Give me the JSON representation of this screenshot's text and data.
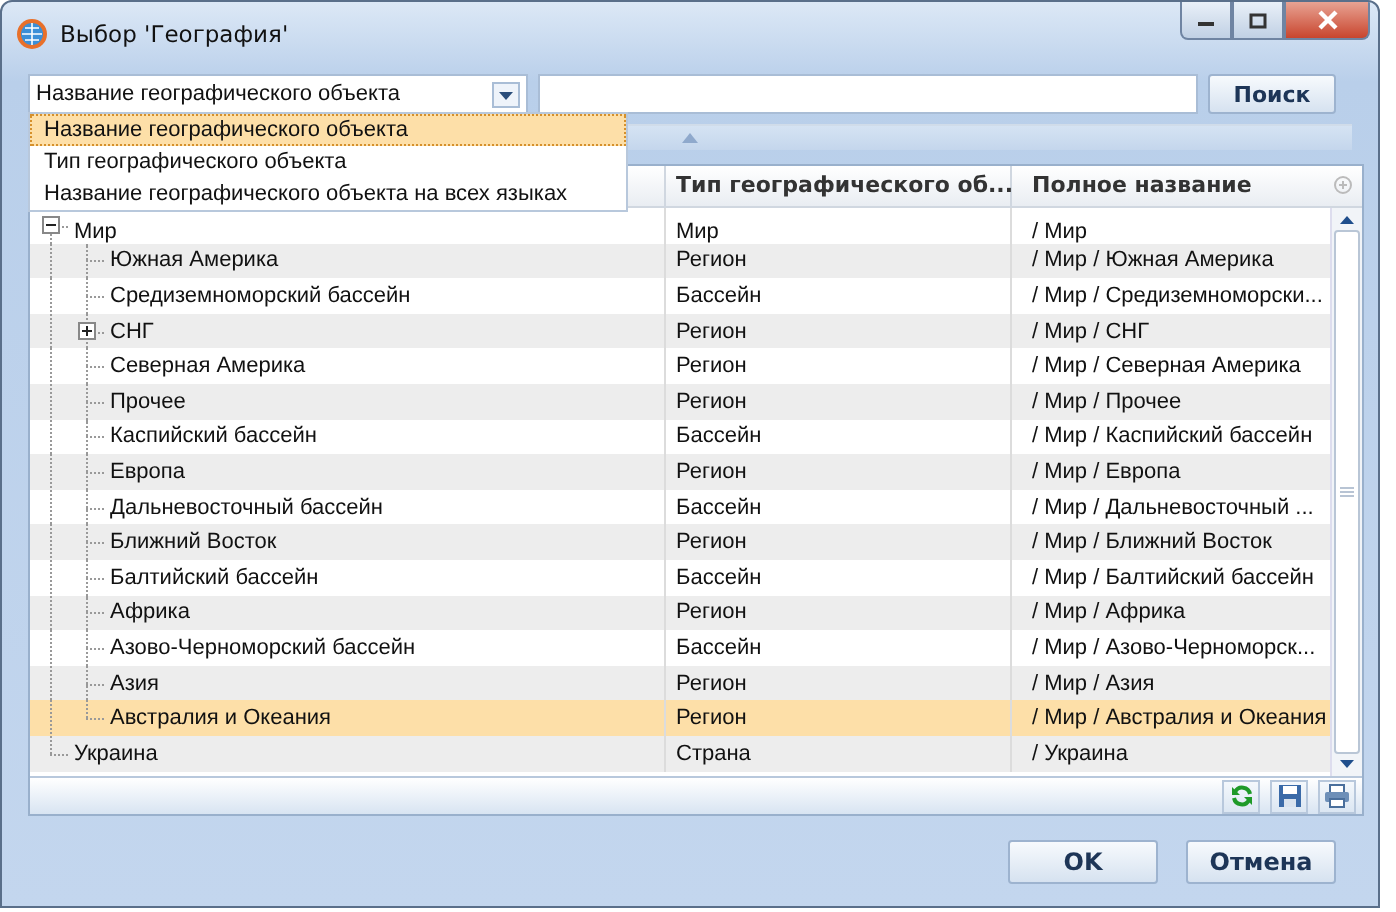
{
  "window": {
    "title": "Выбор 'География'"
  },
  "search": {
    "field_selector": {
      "value": "Название географического объекта",
      "open": true,
      "options": [
        {
          "label": "Название географического объекта",
          "selected": true
        },
        {
          "label": "Тип географического объекта",
          "selected": false
        },
        {
          "label": "Название географического объекта на всех языках",
          "selected": false
        }
      ]
    },
    "button": "Поиск"
  },
  "grid": {
    "columns": [
      "Тип географического об...",
      "Полное название"
    ],
    "rows": [
      {
        "name": "Мир",
        "type": "Мир",
        "full_name": "/ Мир",
        "selected": false,
        "expanded": true,
        "children": [
          {
            "name": "Южная Америка",
            "type": "Регион",
            "full_name": "/ Мир / Южная Америка",
            "selected": false
          },
          {
            "name": "Средиземноморский бассейн",
            "type": "Бассейн",
            "full_name": "/ Мир / Средиземноморски...",
            "selected": false
          },
          {
            "name": "СНГ",
            "type": "Регион",
            "full_name": "/ Мир / СНГ",
            "selected": false,
            "expanded": false
          },
          {
            "name": "Северная Америка",
            "type": "Регион",
            "full_name": "/ Мир / Северная Америка",
            "selected": false
          },
          {
            "name": "Прочее",
            "type": "Регион",
            "full_name": "/ Мир / Прочее",
            "selected": false
          },
          {
            "name": "Каспийский бассейн",
            "type": "Бассейн",
            "full_name": "/ Мир / Каспийский бассейн",
            "selected": false
          },
          {
            "name": "Европа",
            "type": "Регион",
            "full_name": "/ Мир / Европа",
            "selected": false
          },
          {
            "name": "Дальневосточный бассейн",
            "type": "Бассейн",
            "full_name": "/ Мир / Дальневосточный ...",
            "selected": false
          },
          {
            "name": "Ближний Восток",
            "type": "Регион",
            "full_name": "/ Мир / Ближний Восток",
            "selected": false
          },
          {
            "name": "Балтийский бассейн",
            "type": "Бассейн",
            "full_name": "/ Мир / Балтийский бассейн",
            "selected": false
          },
          {
            "name": "Африка",
            "type": "Регион",
            "full_name": "/ Мир / Африка",
            "selected": false
          },
          {
            "name": "Азово-Черноморский бассейн",
            "type": "Бассейн",
            "full_name": "/ Мир / Азово-Черноморск...",
            "selected": false
          },
          {
            "name": "Азия",
            "type": "Регион",
            "full_name": "/ Мир / Азия",
            "selected": false
          },
          {
            "name": "Австралия и Океания",
            "type": "Регион",
            "full_name": "/ Мир / Австралия и Океания",
            "selected": true
          }
        ]
      },
      {
        "name": "Украина",
        "type": "Страна",
        "full_name": "/ Украина",
        "selected": false
      }
    ]
  },
  "buttons": [
    "OK",
    "Отмена"
  ]
}
